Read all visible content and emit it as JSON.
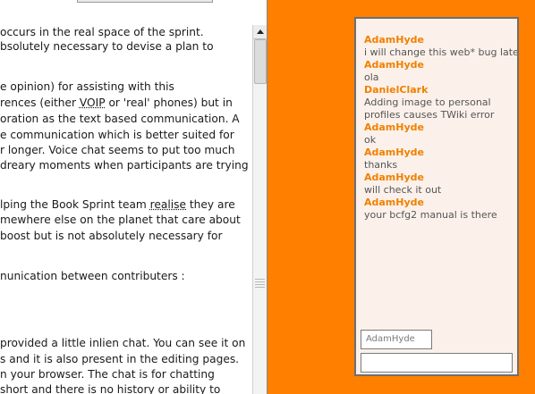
{
  "document": {
    "lines": [
      {
        "text": "occurs in the real space of the sprint."
      },
      {
        "text": "bsolutely necessary to devise a plan to"
      },
      {
        "text": ""
      },
      {
        "text": "e opinion) for assisting with this"
      },
      {
        "text_parts": [
          "rences (either ",
          "VOIP",
          " or 'real' phones) but in"
        ]
      },
      {
        "text": "oration as the text based communication. A"
      },
      {
        "text": "e communication which is better suited for"
      },
      {
        "text": "r longer. Voice chat seems to put too much"
      },
      {
        "text": "dreary moments when participants are trying"
      },
      {
        "text": ""
      },
      {
        "text_parts": [
          "lping the Book Sprint team ",
          "realise",
          " they are"
        ]
      },
      {
        "text": "mewhere else on the planet that care about"
      },
      {
        "text": " boost but is not absolutely necessary for"
      },
      {
        "text": ""
      },
      {
        "text": ""
      },
      {
        "text": "nunication between contributers :"
      },
      {
        "text": ""
      },
      {
        "text": ""
      },
      {
        "text": ""
      },
      {
        "text": "provided a little inlien chat. You can see it on"
      },
      {
        "text": "s and it is also present in the editing pages."
      },
      {
        "text": "n your browser. The chat is for chatting"
      },
      {
        "text": " short and there is no history or ability to"
      }
    ]
  },
  "chat": {
    "messages": [
      {
        "user": "AdamHyde",
        "text": "i will change this web* bug later"
      },
      {
        "user": "AdamHyde",
        "text": "ola"
      },
      {
        "user": "DanielClark",
        "text": "Adding image to personal"
      },
      {
        "user": "",
        "text": "profiles causes TWiki error"
      },
      {
        "user": "AdamHyde",
        "text": "ok"
      },
      {
        "user": "AdamHyde",
        "text": "thanks"
      },
      {
        "user": "AdamHyde",
        "text": "will check it out"
      },
      {
        "user": "AdamHyde",
        "text": "your bcfg2 manual is there"
      }
    ],
    "name_input_value": "AdamHyde",
    "message_input_value": ""
  },
  "colors": {
    "background": "#ff7f00",
    "chat_username": "#f08000",
    "chat_panel_bg": "#fbf1ea"
  }
}
